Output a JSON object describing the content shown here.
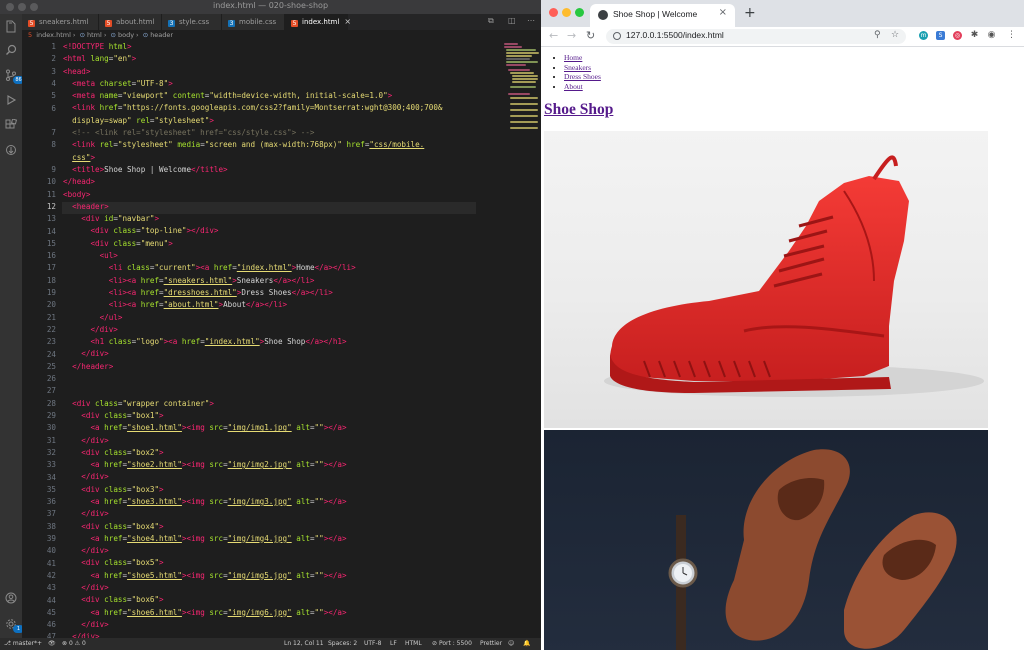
{
  "editor": {
    "window_title": "index.html — 020-shoe-shop",
    "tabs": [
      {
        "label": "sneakers.html",
        "icon": "html-file-icon"
      },
      {
        "label": "about.html",
        "icon": "html-file-icon"
      },
      {
        "label": "style.css",
        "icon": "css-file-icon"
      },
      {
        "label": "mobile.css",
        "icon": "css-file-icon"
      },
      {
        "label": "index.html",
        "icon": "html-file-icon",
        "active": true
      }
    ],
    "breadcrumb": [
      "index.html",
      "html",
      "body",
      "header"
    ],
    "source_control_badge": "86",
    "accounts_badge": "1",
    "line_numbers": [
      "1",
      "2",
      "3",
      "4",
      "5",
      "6",
      "",
      "7",
      "8",
      "",
      "9",
      "10",
      "11",
      "12",
      "13",
      "14",
      "15",
      "16",
      "17",
      "18",
      "19",
      "20",
      "21",
      "22",
      "23",
      "24",
      "25",
      "26",
      "27",
      "28",
      "29",
      "30",
      "31",
      "32",
      "33",
      "34",
      "35",
      "36",
      "37",
      "38",
      "39",
      "40",
      "41",
      "42",
      "43",
      "44",
      "45",
      "46",
      "47"
    ],
    "status": {
      "branch": "master*+",
      "problems": "0 ⚠ 0",
      "cursor": "Ln 12, Col 11",
      "spaces": "Spaces: 2",
      "encoding": "UTF-8",
      "eol": "LF",
      "language": "HTML",
      "port": "Port : 5500",
      "formatter": "Prettier"
    }
  },
  "browser": {
    "tab_title": "Shoe Shop | Welcome",
    "url": "127.0.0.1:5500/index.html",
    "nav_links": [
      "Home",
      "Sneakers",
      "Dress Shoes",
      "About"
    ],
    "logo": "Shoe Shop",
    "images": [
      "red high-top sneaker",
      "brown suede brogues with wristwatch"
    ]
  }
}
